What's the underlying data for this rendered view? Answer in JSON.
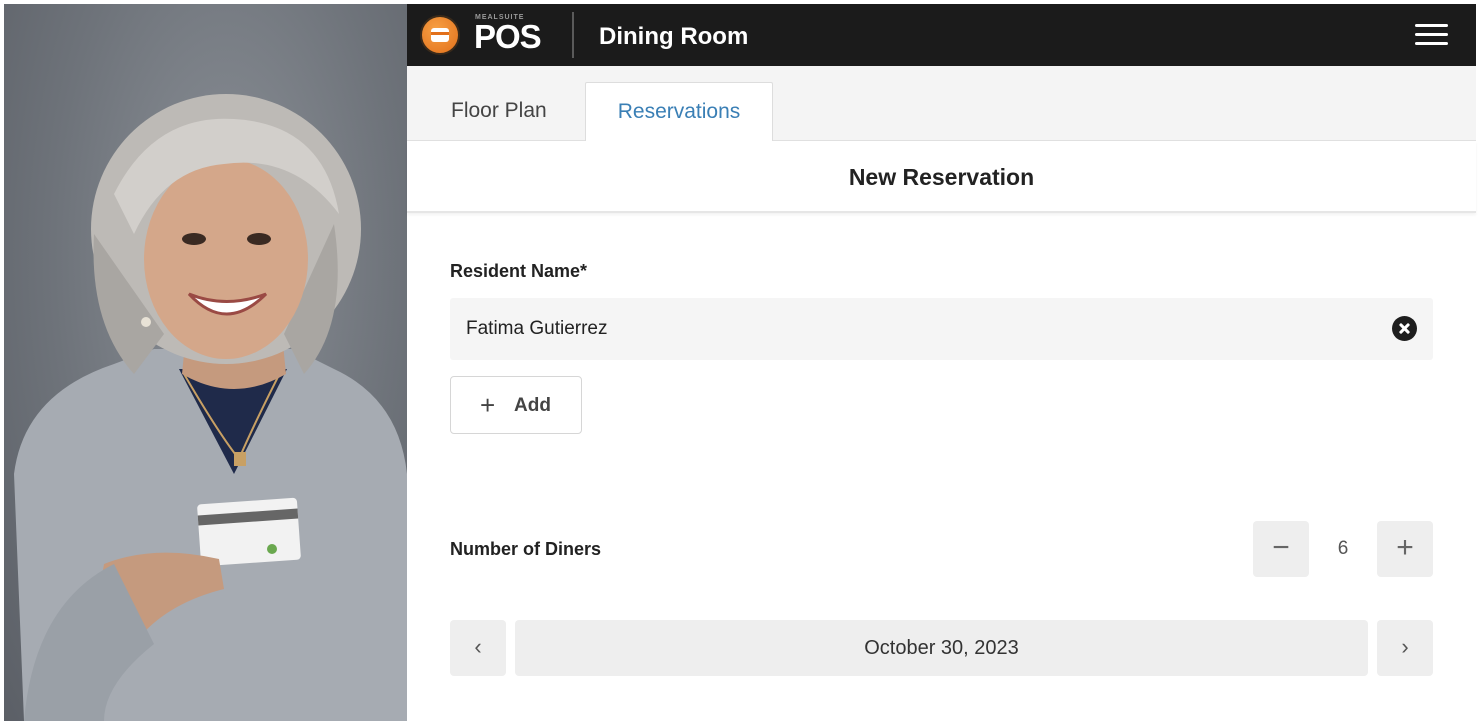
{
  "header": {
    "logo_small": "MEALSUITE",
    "logo_main": "POS",
    "title": "Dining Room"
  },
  "tabs": [
    {
      "label": "Floor Plan",
      "active": false
    },
    {
      "label": "Reservations",
      "active": true
    }
  ],
  "form": {
    "heading": "New Reservation",
    "resident_label": "Resident Name*",
    "resident_value": "Fatima Gutierrez",
    "add_label": "Add",
    "diners_label": "Number of Diners",
    "diners_count": "6",
    "date_value": "October 30, 2023"
  },
  "icons": {
    "menu": "hamburger-icon",
    "clear": "close-circle-icon",
    "add": "plus-icon",
    "decrement": "minus-icon",
    "increment": "plus-icon",
    "prev": "chevron-left-icon",
    "next": "chevron-right-icon"
  },
  "colors": {
    "topbar": "#1b1b1b",
    "accent_tab": "#3a7fb5",
    "logo_orange": "#e2701b"
  }
}
